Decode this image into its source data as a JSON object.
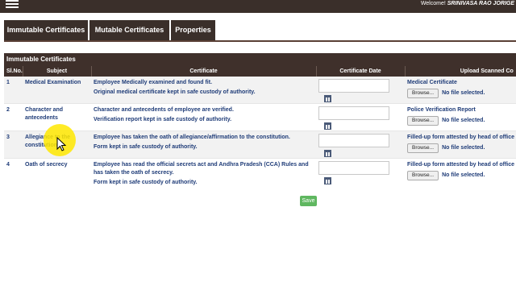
{
  "header": {
    "welcome_prefix": "Welcome!",
    "user_name": "SRINIVASA RAO JORIGE"
  },
  "tabs": [
    {
      "label": "Immutable Certificates"
    },
    {
      "label": "Mutable Certificates"
    },
    {
      "label": "Properties"
    }
  ],
  "panel": {
    "title": "Immutable Certificates",
    "columns": [
      "Sl.No.",
      "Subject",
      "Certificate",
      "Certificate Date",
      "Upload Scanned Co"
    ]
  },
  "rows": [
    {
      "no": "1",
      "subject": "Medical Examination",
      "cert1": "Employee Medically examined and found fit.",
      "cert2": "Original medical certificate kept in safe custody of authority.",
      "upload_label": "Medical Certificate",
      "browse": "Browse...",
      "nofile": "No file selected."
    },
    {
      "no": "2",
      "subject": "Character and antecedents",
      "cert1": "Character and antecedents of employee are verified.",
      "cert2": "Verification report kept in safe custody of authority.",
      "upload_label": "Police Verification Report",
      "browse": "Browse...",
      "nofile": "No file selected."
    },
    {
      "no": "3",
      "subject": "Allegiance to the constitution",
      "cert1": "Employee has taken the oath of allegiance/affirmation to the constitution.",
      "cert2": "Form kept in safe custody of authority.",
      "upload_label": "Filled-up form attested by head of office",
      "browse": "Browse...",
      "nofile": "No file selected."
    },
    {
      "no": "4",
      "subject": "Oath of secrecy",
      "cert1": "Employee has read the official secrets act and Andhra Pradesh (CCA) Rules and has taken the oath of secrecy.",
      "cert2": "Form kept in safe custody of authority.",
      "upload_label": "Filled-up form attested by head of office",
      "browse": "Browse...",
      "nofile": "No file selected."
    }
  ],
  "save_label": "Save",
  "icons": {
    "menu": "hamburger-icon",
    "calendar": "calendar-icon",
    "cursor": "mouse-pointer-icon"
  },
  "colors": {
    "bar": "#3a2f2a",
    "text": "#1f3c78",
    "save": "#5fb760",
    "highlight": "#ffe800"
  }
}
